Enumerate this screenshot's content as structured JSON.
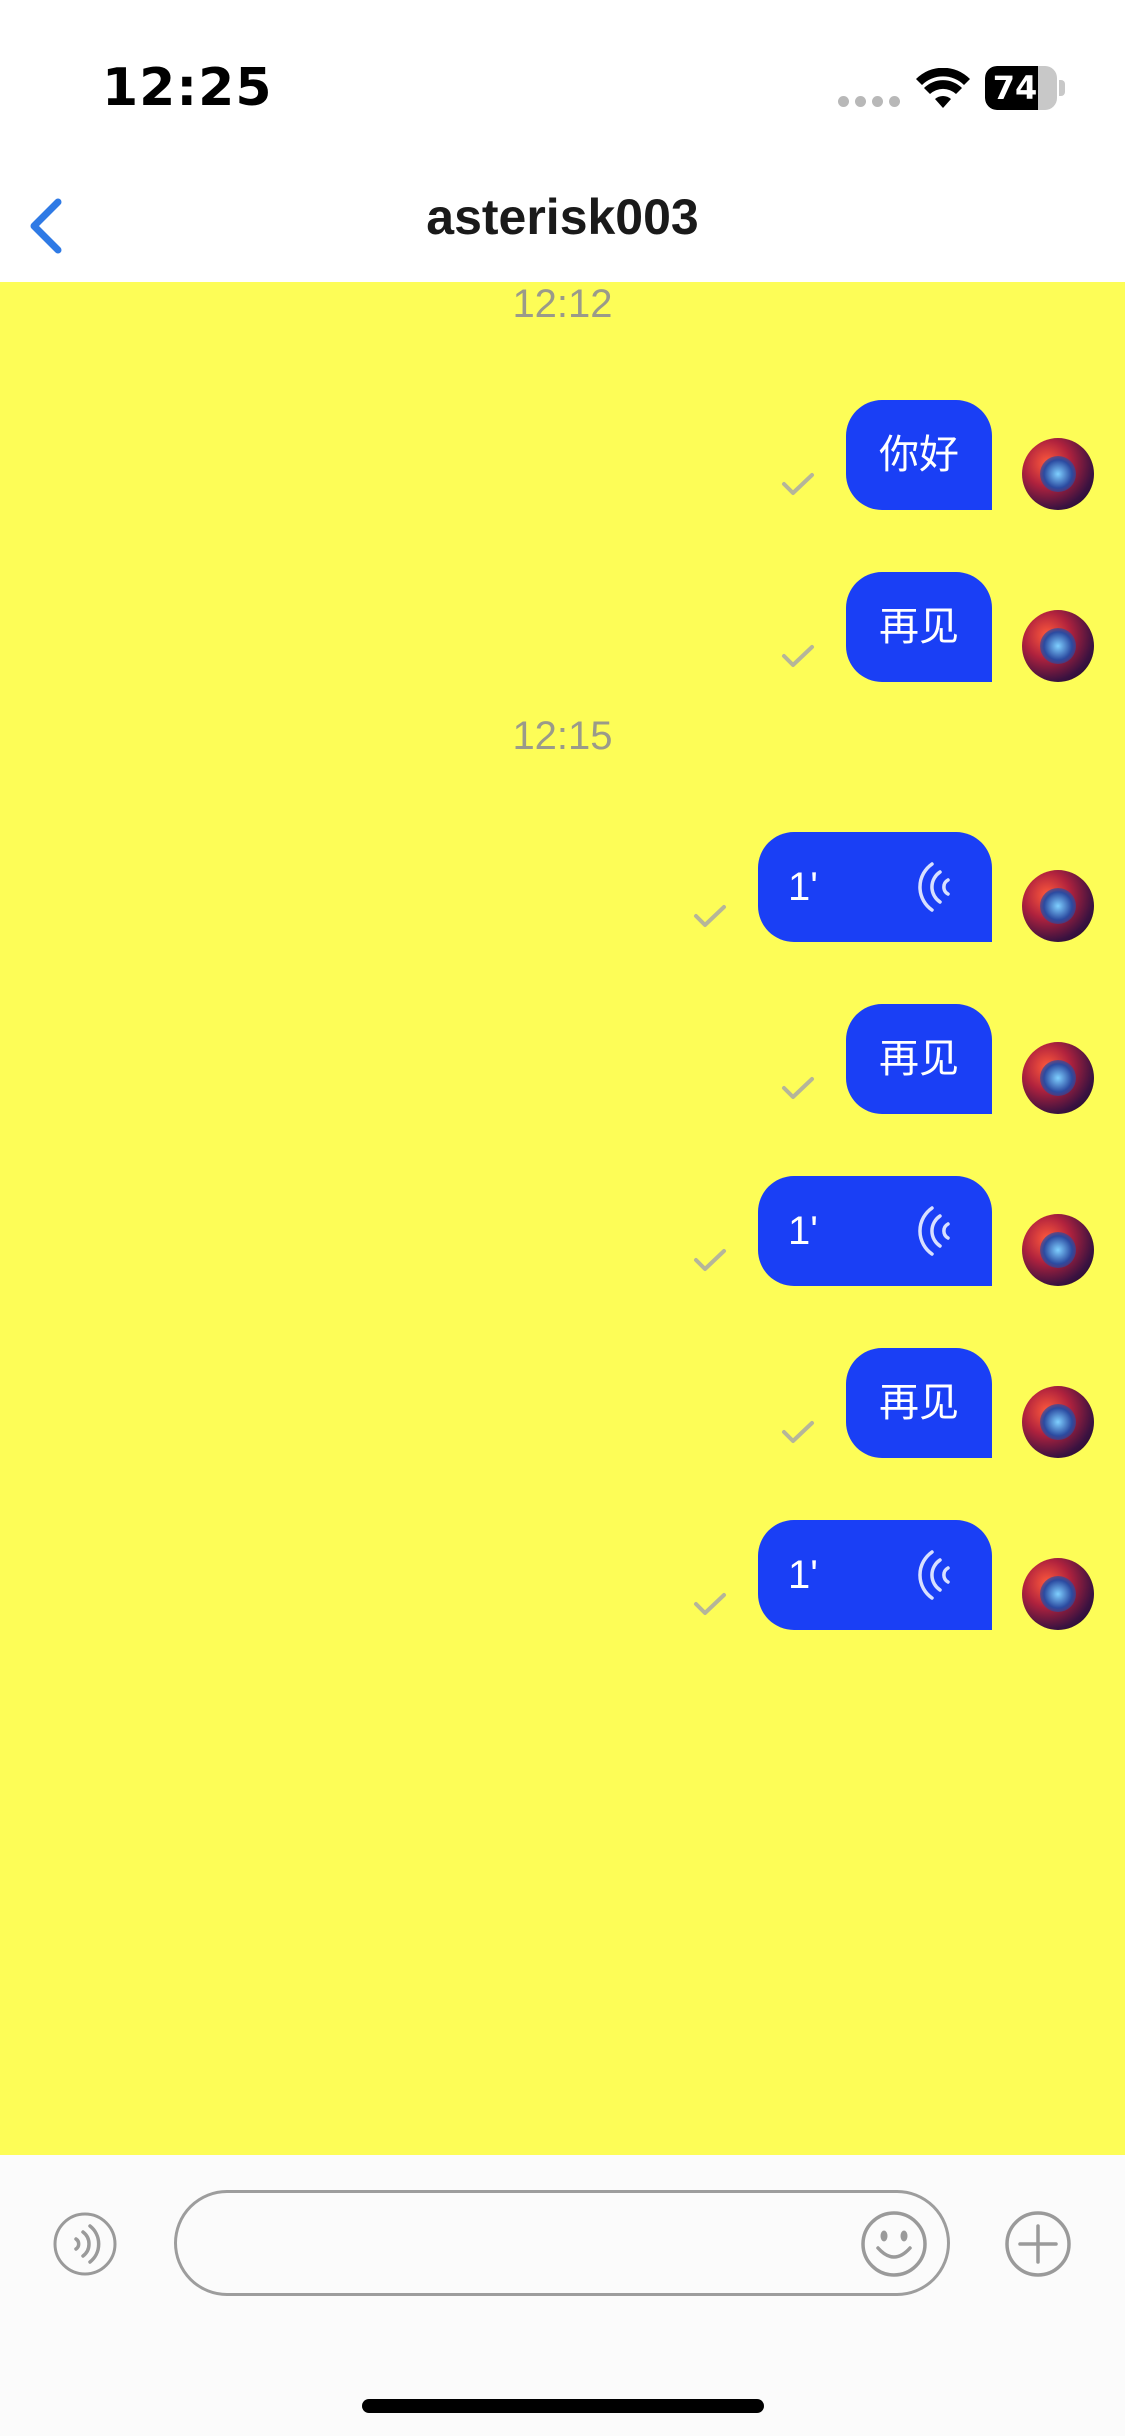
{
  "status_bar": {
    "time": "12:25",
    "battery": "74",
    "battery_level": 0.74
  },
  "nav": {
    "title": "asterisk003",
    "back_icon": "chevron-left-icon"
  },
  "colors": {
    "chat_background": "#fdfd57",
    "bubble": "#1a3ff5",
    "accent": "#2f7ae5"
  },
  "chat": {
    "items": [
      {
        "kind": "time",
        "text": "12:12"
      },
      {
        "kind": "text",
        "text": "你好",
        "status": "sent"
      },
      {
        "kind": "text",
        "text": "再见",
        "status": "sent"
      },
      {
        "kind": "time",
        "text": "12:15"
      },
      {
        "kind": "voice",
        "duration": "1'",
        "status": "sent"
      },
      {
        "kind": "text",
        "text": "再见",
        "status": "sent"
      },
      {
        "kind": "voice",
        "duration": "1'",
        "status": "sent"
      },
      {
        "kind": "text",
        "text": "再见",
        "status": "sent"
      },
      {
        "kind": "voice",
        "duration": "1'",
        "status": "sent"
      }
    ]
  },
  "input_bar": {
    "message_value": "",
    "message_placeholder": "",
    "voice_icon": "voice-wave-icon",
    "emoji_icon": "smiley-icon",
    "plus_icon": "plus-circle-icon"
  }
}
